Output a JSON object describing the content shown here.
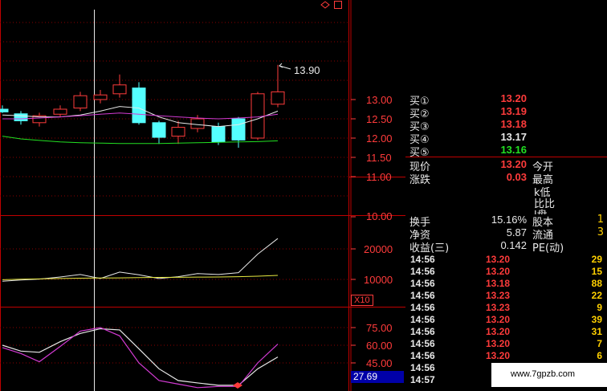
{
  "header": {
    "corner_icon": "diamond-icon"
  },
  "chart_data": [
    {
      "type": "candlestick",
      "title": "",
      "price_labels": [
        "13.00",
        "12.50",
        "12.00",
        "11.50",
        "11.00"
      ],
      "callout_high": "13.90",
      "candles": [
        {
          "o": 12.75,
          "c": 12.68,
          "h": 12.85,
          "l": 12.65,
          "color": "cyan"
        },
        {
          "o": 12.63,
          "c": 12.45,
          "h": 12.7,
          "l": 12.35,
          "color": "cyan"
        },
        {
          "o": 12.4,
          "c": 12.58,
          "h": 12.66,
          "l": 12.3,
          "color": "red"
        },
        {
          "o": 12.62,
          "c": 12.75,
          "h": 12.85,
          "l": 12.55,
          "color": "red"
        },
        {
          "o": 12.78,
          "c": 13.1,
          "h": 13.2,
          "l": 12.7,
          "color": "red"
        },
        {
          "o": 13.0,
          "c": 13.12,
          "h": 13.25,
          "l": 12.9,
          "color": "red"
        },
        {
          "o": 13.15,
          "c": 13.38,
          "h": 13.65,
          "l": 13.05,
          "color": "red"
        },
        {
          "o": 13.3,
          "c": 12.4,
          "h": 13.45,
          "l": 12.35,
          "color": "cyan"
        },
        {
          "o": 12.4,
          "c": 12.02,
          "h": 12.45,
          "l": 11.85,
          "color": "cyan"
        },
        {
          "o": 12.05,
          "c": 12.28,
          "h": 12.45,
          "l": 11.85,
          "color": "red"
        },
        {
          "o": 12.25,
          "c": 12.5,
          "h": 12.6,
          "l": 12.15,
          "color": "red"
        },
        {
          "o": 12.3,
          "c": 11.9,
          "h": 12.4,
          "l": 11.82,
          "color": "cyan"
        },
        {
          "o": 12.5,
          "c": 11.95,
          "h": 12.55,
          "l": 11.75,
          "color": "cyan"
        },
        {
          "o": 12.0,
          "c": 13.15,
          "h": 13.2,
          "l": 11.95,
          "color": "red"
        },
        {
          "o": 12.88,
          "c": 13.2,
          "h": 13.9,
          "l": 12.8,
          "color": "red"
        }
      ],
      "ma_white": [
        12.6,
        12.58,
        12.55,
        12.55,
        12.6,
        12.7,
        12.82,
        12.78,
        12.55,
        12.4,
        12.35,
        12.3,
        12.35,
        12.5,
        12.7
      ],
      "ma_magenta": [
        12.5,
        12.5,
        12.52,
        12.55,
        12.58,
        12.62,
        12.65,
        12.62,
        12.58,
        12.55,
        12.52,
        12.5,
        12.52,
        12.55,
        12.62
      ],
      "ma_green": [
        12.05,
        11.98,
        11.94,
        11.9,
        11.88,
        11.87,
        11.86,
        11.86,
        11.86,
        11.87,
        11.88,
        11.89,
        11.9,
        11.91,
        11.93
      ]
    },
    {
      "type": "line",
      "title": "",
      "scale_labels": [
        "10.00",
        "20000",
        "10000"
      ],
      "multiplier_label": "X10",
      "series": [
        {
          "color": "#e8e8e8",
          "values": [
            9400,
            9800,
            10100,
            10800,
            11600,
            10300,
            12400,
            11500,
            10300,
            10900,
            11900,
            11600,
            12200,
            18300,
            23400
          ]
        },
        {
          "color": "#e8e840",
          "values": [
            9900,
            10050,
            10150,
            10300,
            10400,
            10450,
            10500,
            10600,
            10650,
            10700,
            10750,
            10800,
            10900,
            11050,
            11300
          ]
        }
      ]
    },
    {
      "type": "line",
      "title": "",
      "scale_labels": [
        "75.00",
        "60.00",
        "45.00"
      ],
      "current_value_label": "27.69",
      "series": [
        {
          "color": "#e8e8e8",
          "values": [
            60,
            55,
            54,
            63,
            70,
            74,
            73,
            57,
            40,
            30,
            28,
            26,
            26,
            40,
            50
          ]
        },
        {
          "color": "#d23ad2",
          "values": [
            58,
            53,
            46,
            59,
            72,
            75,
            68,
            45,
            30,
            27,
            24,
            25,
            25,
            45,
            61
          ]
        }
      ]
    }
  ],
  "quotes": {
    "bids": [
      {
        "label": "买①",
        "price": "13.20",
        "color": "#ff3b3b"
      },
      {
        "label": "买②",
        "price": "13.19",
        "color": "#ff3b3b"
      },
      {
        "label": "买③",
        "price": "13.18",
        "color": "#ff3b3b"
      },
      {
        "label": "买④",
        "price": "13.17",
        "color": "#e8e8e8"
      },
      {
        "label": "买⑤",
        "price": "13.16",
        "color": "#22e022"
      }
    ],
    "current_label": "现价",
    "current_value": "13.20",
    "open_label": "今开",
    "change_label": "涨跌",
    "change_value": "0.03",
    "high_label": "最高",
    "partial_low": "k低",
    "partial_ratio": "比比",
    "partial_outer": "l盘",
    "turnover_label": "换手",
    "turnover_value": "15.16%",
    "equity_label": "股本",
    "equity_value": "1",
    "netasset_label": "净资",
    "netasset_value": "5.87",
    "float_label": "流通",
    "float_value": "3",
    "earn_label": "收益(三)",
    "earn_value": "0.142",
    "pe_label": "PE(动)"
  },
  "ticks": [
    {
      "time": "14:56",
      "price": "13.20",
      "volume": "29",
      "color": "#ff3b3b"
    },
    {
      "time": "14:56",
      "price": "13.20",
      "volume": "15",
      "color": "#ff3b3b"
    },
    {
      "time": "14:56",
      "price": "13.18",
      "volume": "88",
      "color": "#ff3b3b"
    },
    {
      "time": "14:56",
      "price": "13.23",
      "volume": "22",
      "color": "#ff3b3b"
    },
    {
      "time": "14:56",
      "price": "13.23",
      "volume": "9",
      "color": "#ff3b3b"
    },
    {
      "time": "14:56",
      "price": "13.20",
      "volume": "39",
      "color": "#ff3b3b"
    },
    {
      "time": "14:56",
      "price": "13.20",
      "volume": "31",
      "color": "#ff3b3b"
    },
    {
      "time": "14:56",
      "price": "13.20",
      "volume": "7",
      "color": "#ff3b3b"
    },
    {
      "time": "14:56",
      "price": "13.20",
      "volume": "6",
      "color": "#ff3b3b"
    },
    {
      "time": "14:56",
      "price": "",
      "volume": "",
      "color": "#ff3b3b"
    },
    {
      "time": "14:57",
      "price": "",
      "volume": "",
      "color": "#ff3b3b"
    }
  ],
  "watermark": {
    "text": "www.7gpzb.com"
  }
}
